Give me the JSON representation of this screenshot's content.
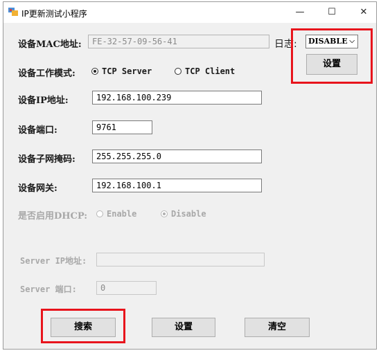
{
  "window": {
    "title": "IP更新测试小程序",
    "controls": {
      "minimize": "—",
      "maximize": "☐",
      "close": "✕"
    }
  },
  "form": {
    "mac": {
      "label": "设备MAC地址:",
      "value": "FE-32-57-09-56-41"
    },
    "mode": {
      "label": "设备工作模式:",
      "options": [
        "TCP Server",
        "TCP Client"
      ],
      "selected": "TCP Server"
    },
    "ip": {
      "label": "设备IP地址:",
      "value": "192.168.100.239"
    },
    "port": {
      "label": "设备端口:",
      "value": "9761"
    },
    "subnet": {
      "label": "设备子网掩码:",
      "value": "255.255.255.0"
    },
    "gateway": {
      "label": "设备网关:",
      "value": "192.168.100.1"
    },
    "dhcp": {
      "label": "是否启用DHCP:",
      "options": [
        "Enable",
        "Disable"
      ],
      "selected": "Disable",
      "enabled": false
    },
    "server_ip": {
      "label": "Server IP地址:",
      "value": "",
      "enabled": false
    },
    "server_port": {
      "label": "Server 端口:",
      "value": "0",
      "enabled": false
    }
  },
  "log": {
    "label": "日志:",
    "selected": "DISABLE",
    "set_button": "设置"
  },
  "buttons": {
    "search": "搜索",
    "set": "设置",
    "clear": "清空"
  },
  "colors": {
    "highlight": "#e8141c",
    "window_bg": "#f0f0f0",
    "button_bg": "#e1e1e1"
  }
}
